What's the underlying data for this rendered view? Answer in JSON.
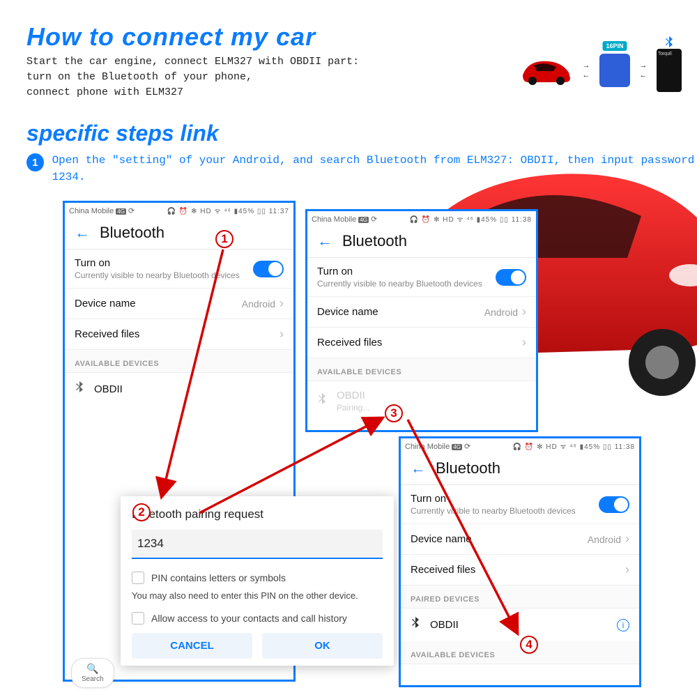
{
  "title": "How to connect my car",
  "intro": "Start the car engine, connect ELM327 with OBDII part:\nturn on the Bluetooth of your phone,\nconnect phone with ELM327",
  "diagram": {
    "obd_label": "16PIN",
    "phone_label": "TorquE"
  },
  "subtitle": "specific steps link",
  "step": {
    "num": "1",
    "text": "Open the \"setting\" of your Android, and search Bluetooth\nfrom ELM327: OBDII, then input password 1234."
  },
  "statusbar": {
    "carrier": "China Mobile",
    "icons": "🎧 ⏰ ✻ HD ᯤ ⁴⁶ ▮45%",
    "time1": "11:37",
    "time2": "11:38",
    "time3": "11:38"
  },
  "bt": {
    "header": "Bluetooth",
    "turn_on": "Turn on",
    "visible_hint": "Currently visible to nearby Bluetooth devices",
    "device_name_label": "Device name",
    "device_name_value": "Android",
    "received_files": "Received files",
    "available": "AVAILABLE DEVICES",
    "paired": "PAIRED DEVICES",
    "obd": "OBDII",
    "pairing": "Pairing..."
  },
  "dialog": {
    "title": "Bluetooth pairing request",
    "pin": "1234",
    "pin_letters": "PIN contains letters or symbols",
    "hint": "You may also need to enter this PIN on the other device.",
    "allow": "Allow access to your contacts and call history",
    "cancel": "CANCEL",
    "ok": "OK"
  },
  "search": {
    "label": "Search"
  },
  "red": {
    "n1": "1",
    "n2": "2",
    "n3": "3",
    "n4": "4"
  }
}
